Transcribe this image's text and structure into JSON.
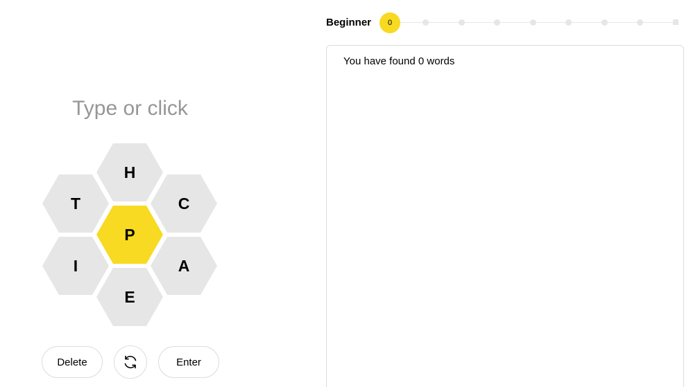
{
  "input": {
    "placeholder": "Type or click"
  },
  "hive": {
    "center_letter": "P",
    "outer_letters": {
      "top": "H",
      "upper_left": "T",
      "upper_right": "C",
      "lower_left": "I",
      "lower_right": "A",
      "bottom": "E"
    }
  },
  "controls": {
    "delete_label": "Delete",
    "shuffle_icon": "shuffle-icon",
    "enter_label": "Enter"
  },
  "progress": {
    "rank": "Beginner",
    "score": "0",
    "step_index": 0,
    "step_count": 9
  },
  "wordlist": {
    "heading": "You have found 0 words",
    "words": []
  },
  "colors": {
    "accent": "#f7da21",
    "cell": "#e6e6e6",
    "placeholder": "#969696",
    "border": "#dcdcdc"
  }
}
